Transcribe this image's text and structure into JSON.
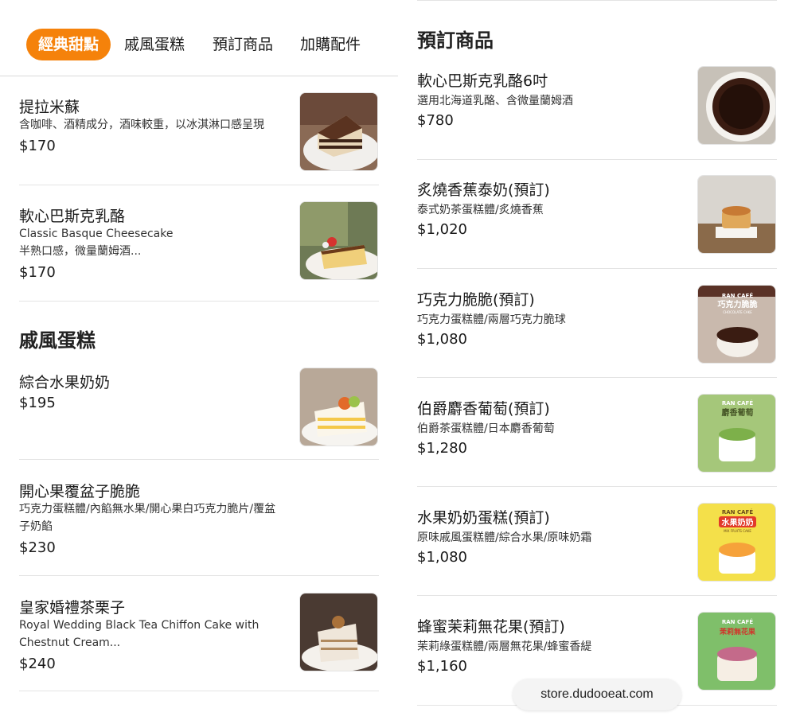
{
  "tabs": [
    {
      "label": "經典甜點",
      "active": true
    },
    {
      "label": "戚風蛋糕",
      "active": false
    },
    {
      "label": "預訂商品",
      "active": false
    },
    {
      "label": "加購配件",
      "active": false
    }
  ],
  "accent_color": "#f5820b",
  "left": {
    "items_top": [
      {
        "name": "提拉米蘇",
        "desc": "含咖啡、酒精成分，酒味較重，以冰淇淋口感呈現",
        "price": "$170",
        "icon": "tiramisu-photo"
      },
      {
        "name": "軟心巴斯克乳酪",
        "desc_lines": [
          "Classic Basque Cheesecake",
          "半熟口感，微量蘭姆酒..."
        ],
        "price": "$170",
        "icon": "basque-cheesecake-photo"
      }
    ],
    "section_title": "戚風蛋糕",
    "items_chiffon": [
      {
        "name": "綜合水果奶奶",
        "price": "$195",
        "icon": "fruit-cake-photo"
      },
      {
        "name": "開心果覆盆子脆脆",
        "desc_lines": [
          "巧克力蛋糕體/內餡無水果/開心果白巧克力脆片/覆盆",
          "子奶餡"
        ],
        "price": "$230"
      },
      {
        "name": "皇家婚禮茶栗子",
        "desc_lines": [
          "Royal Wedding Black Tea Chiffon Cake with",
          "Chestnut Cream..."
        ],
        "price": "$240",
        "icon": "chestnut-cake-photo"
      }
    ]
  },
  "right": {
    "section_title": "預訂商品",
    "items": [
      {
        "name": "軟心巴斯克乳酪6吋",
        "desc": "選用北海道乳酪、含微量蘭姆酒",
        "price": "$780",
        "icon": "basque-whole-photo"
      },
      {
        "name": "炙燒香蕉泰奶(預訂)",
        "desc": "泰式奶茶蛋糕體/炙燒香蕉",
        "price": "$1,020",
        "icon": "banana-thai-tea-photo"
      },
      {
        "name": "巧克力脆脆(預訂)",
        "desc": "巧克力蛋糕體/兩層巧克力脆球",
        "price": "$1,080",
        "icon": "chocolate-cake-poster",
        "poster_brand": "RAN CAFÉ",
        "poster_title": "巧克力脆脆",
        "poster_sub": "CHOCOLATE CAKE"
      },
      {
        "name": "伯爵麝香葡萄(預訂)",
        "desc": "伯爵茶蛋糕體/日本麝香葡萄",
        "price": "$1,280",
        "icon": "grape-cake-poster",
        "poster_brand": "RAN CAFÉ",
        "poster_title": "麝香葡萄"
      },
      {
        "name": "水果奶奶蛋糕(預訂)",
        "desc": "原味戚風蛋糕體/綜合水果/原味奶霜",
        "price": "$1,080",
        "icon": "fruit-cake-poster",
        "poster_brand": "RAN CAFÉ",
        "poster_title": "水果奶奶",
        "poster_sub": "MIX FRUITS CAKE"
      },
      {
        "name": "蜂蜜茉莉無花果(預訂)",
        "desc": "茉莉綠蛋糕體/兩層無花果/蜂蜜香緹",
        "price": "$1,160",
        "icon": "fig-cake-poster",
        "poster_brand": "RAN CAFÉ",
        "poster_title": "茉莉無花果"
      }
    ]
  },
  "footer_url": "store.dudooeat.com"
}
